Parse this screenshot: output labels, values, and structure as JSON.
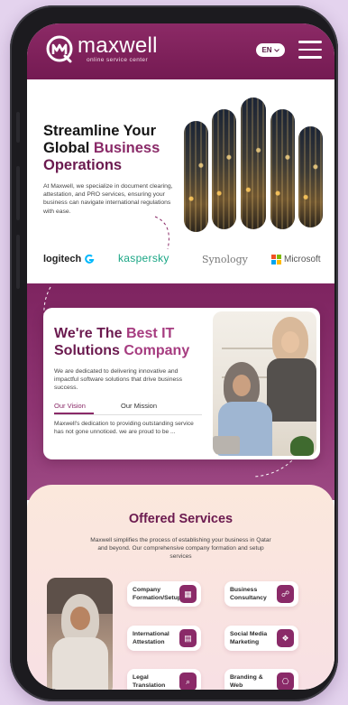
{
  "header": {
    "logo_name": "maxwell",
    "logo_sub": "online service center",
    "lang": "EN"
  },
  "hero": {
    "title_line1": "Streamline Your",
    "title_line2_plain": "Global ",
    "title_line2_accent": "Business",
    "title_line3": "Operations",
    "description": "At Maxwell, we specialize in document clearing, attestation, and PRO services, ensuring your business can navigate international regulations with ease."
  },
  "brands": {
    "logitech": "logitech",
    "kaspersky": "kaspersky",
    "synology": "Synology",
    "microsoft": "Microsoft"
  },
  "about": {
    "title_plain1": "We're The ",
    "title_accent1": "Best IT",
    "title_plain2": "Solutions ",
    "title_accent2": "Company",
    "description": "We are dedicated to delivering innovative and impactful software solutions that drive business success.",
    "tabs": [
      "Our Vision",
      "Our Mission"
    ],
    "tab_text": "Maxwell's dedication to providing outstanding service has not gone unnoticed. we are proud to be ..."
  },
  "services": {
    "title": "Offered Services",
    "description": "Maxwell simplifies the process of establishing your business in Qatar and beyond. Our comprehensive company formation and setup services",
    "items": [
      {
        "label": "Company Formation/Setup",
        "icon": "chart-icon"
      },
      {
        "label": "Business Consultancy",
        "icon": "consult-icon"
      },
      {
        "label": "International Attestation",
        "icon": "document-icon"
      },
      {
        "label": "Social Media Marketing",
        "icon": "social-icon"
      },
      {
        "label": "Legal Translation Services",
        "icon": "translate-icon"
      },
      {
        "label": "Branding & Web Development",
        "icon": "web-icon"
      }
    ]
  },
  "colors": {
    "brand": "#8a2a68",
    "header_bg": "#7e1f58",
    "phone_frame": "#1c1b1f",
    "page_bg": "#e4d3ee"
  }
}
